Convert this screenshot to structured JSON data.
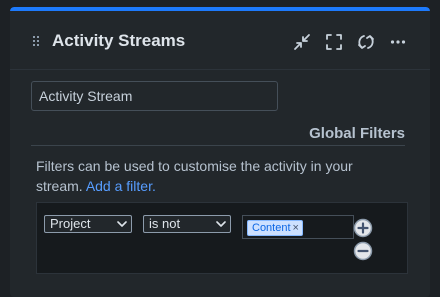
{
  "gadget": {
    "title": "Activity Streams",
    "icons": {
      "drag": "drag-handle-icon",
      "minimize": "minimize-icon",
      "maximize": "maximize-icon",
      "refresh": "refresh-icon",
      "more": "more-icon"
    }
  },
  "form": {
    "stream_name_value": "Activity Stream",
    "section_title": "Global Filters",
    "description": "Filters can be used to customise the activity in your stream.",
    "add_filter_link": "Add a filter."
  },
  "filter_row": {
    "field_select": "Project",
    "operator_select": "is not",
    "value_tag": "Content",
    "remove_tag_glyph": "×",
    "add_icon": "plus-circle-icon",
    "remove_icon": "minus-circle-icon"
  },
  "colors": {
    "accent": "#1d7afc",
    "link": "#579dff",
    "tag_background": "#cce0ff"
  }
}
